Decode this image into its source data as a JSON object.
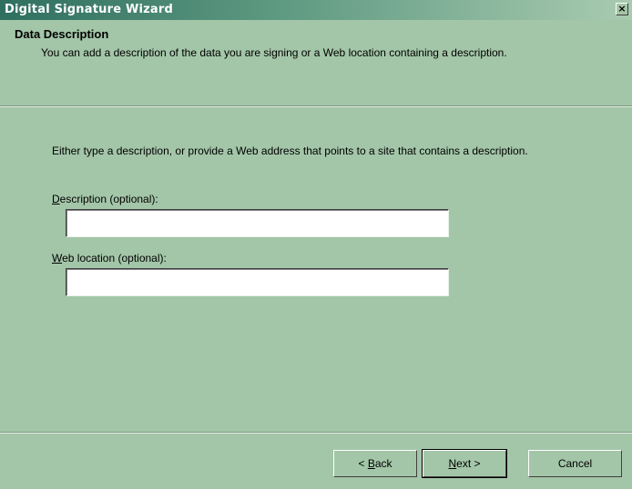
{
  "window": {
    "title": "Digital Signature Wizard",
    "close_label": "×"
  },
  "header": {
    "title": "Data Description",
    "description": "You can add a description of the data you are signing or a Web location containing a description."
  },
  "body": {
    "intro": "Either type a description, or provide a Web address that points to a site that contains a description.",
    "description_field": {
      "mnemonic": "D",
      "label_rest": "escription (optional):",
      "value": ""
    },
    "web_field": {
      "mnemonic": "W",
      "label_rest": "eb location (optional):",
      "value": ""
    }
  },
  "buttons": {
    "back": {
      "prefix": "< ",
      "mnemonic": "B",
      "rest": "ack"
    },
    "next": {
      "mnemonic": "N",
      "rest": "ext >"
    },
    "cancel": "Cancel"
  }
}
